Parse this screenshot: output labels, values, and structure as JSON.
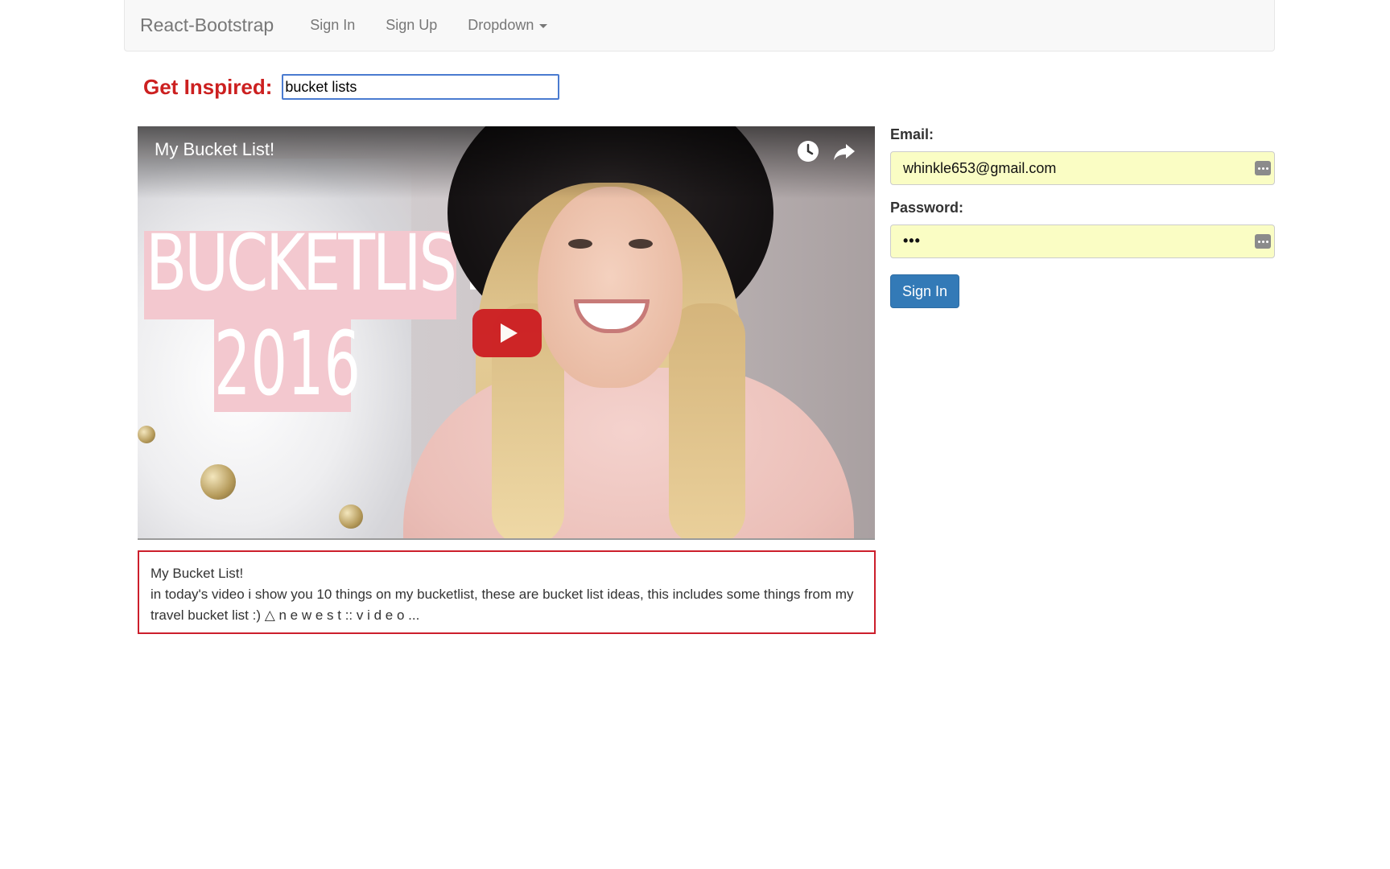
{
  "navbar": {
    "brand": "React-Bootstrap",
    "links": [
      {
        "label": "Sign In"
      },
      {
        "label": "Sign Up"
      },
      {
        "label": "Dropdown"
      }
    ]
  },
  "search": {
    "label": "Get Inspired:",
    "value": "bucket lists"
  },
  "video": {
    "title": "My Bucket List!",
    "thumbnail_text_line1": "BUCKETLIST",
    "thumbnail_text_line2": "2016",
    "icons": [
      "clock-icon",
      "share-icon",
      "play-icon"
    ]
  },
  "description": {
    "title": "My Bucket List!",
    "text": "in today's video i show you 10 things on my bucketlist, these are bucket list ideas, this includes some things from my travel bucket list :) △ n e w e s t :: v i d e o ..."
  },
  "login": {
    "email_label": "Email:",
    "email_value": "whinkle653@gmail.com",
    "password_label": "Password:",
    "password_display": "•••",
    "submit_label": "Sign In"
  },
  "colors": {
    "accent_red": "#cc2020",
    "primary_button": "#337ab7",
    "autofill_bg": "#fafdc4",
    "navbar_bg": "#f8f8f8"
  }
}
